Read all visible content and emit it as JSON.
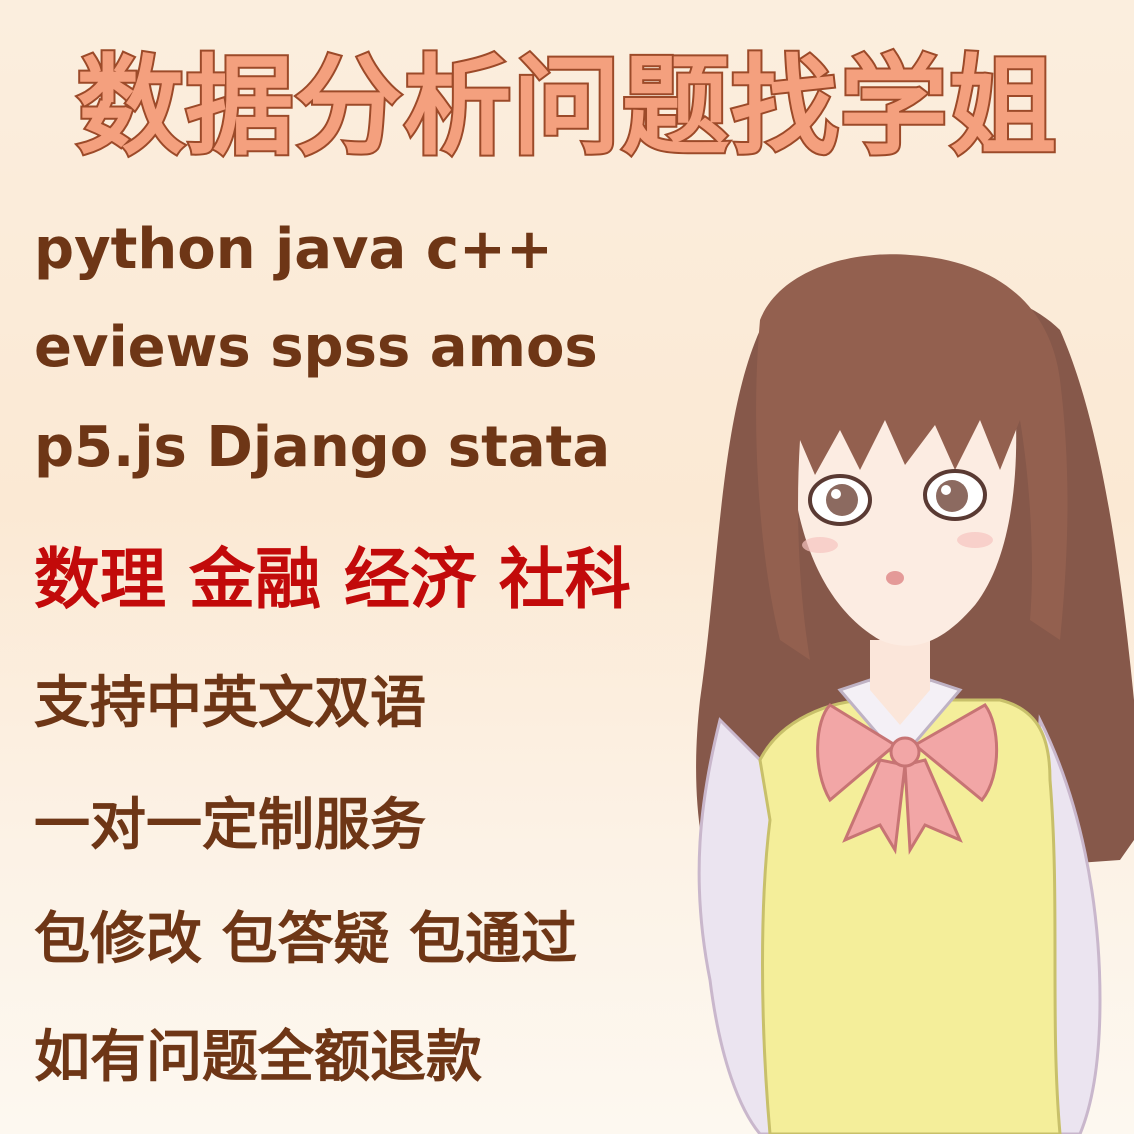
{
  "headline": "数据分析问题找学姐",
  "lines": [
    "python java c++",
    "eviews spss amos",
    "p5.js Django stata",
    "数理 金融 经济 社科",
    "支持中英文双语",
    "一对一定制服务",
    "包修改 包答疑 包通过",
    "如有问题全额退款"
  ],
  "colors": {
    "headline_fill": "#f4a07e",
    "headline_stroke": "#9c4a29",
    "body_text": "#6e3616",
    "highlight_text": "#c20a0a",
    "hair": "#8a5a4a",
    "vest": "#f4ee9a",
    "bow": "#f2a6a6"
  }
}
